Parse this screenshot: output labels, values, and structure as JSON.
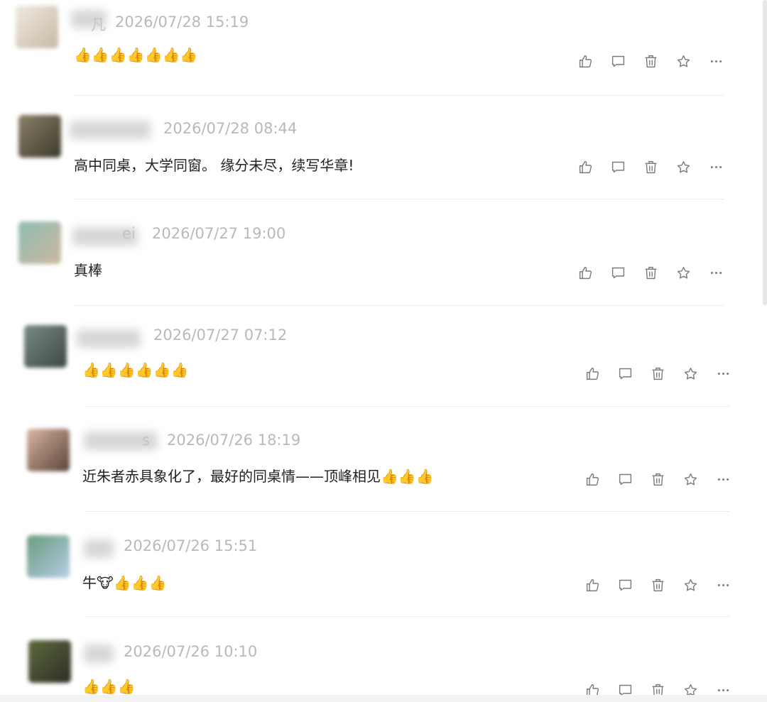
{
  "colors": {
    "timestamp": "#b9b9b9",
    "content_text": "#222222",
    "icon_stroke": "#7a7a7a",
    "divider": "#eeeeee"
  },
  "comments": [
    {
      "name_partial": "凡",
      "timestamp": "2026/07/28 15:19",
      "content": "👍👍👍👍👍👍👍",
      "avatar_colors": [
        "#efeae2",
        "#c7b8a3"
      ]
    },
    {
      "name_partial": "",
      "timestamp": "2026/07/28 08:44",
      "content": "高中同桌，大学同窗。 缘分未尽，续写华章!",
      "avatar_colors": [
        "#8a8068",
        "#3d3a2c"
      ]
    },
    {
      "name_partial": "ei",
      "timestamp": "2026/07/27 19:00",
      "content": "真棒",
      "avatar_colors": [
        "#8fbcb4",
        "#cdb79d"
      ]
    },
    {
      "name_partial": "",
      "timestamp": "2026/07/27 07:12",
      "content": "👍👍👍👍👍👍",
      "avatar_colors": [
        "#7b8a86",
        "#3b4744"
      ]
    },
    {
      "name_partial": "s",
      "timestamp": "2026/07/26 18:19",
      "content": "近朱者赤具象化了，最好的同桌情——顶峰相见👍👍👍",
      "avatar_colors": [
        "#d9b6a3",
        "#5a4337"
      ]
    },
    {
      "name_partial": "",
      "timestamp": "2026/07/26 15:51",
      "content": "牛🐮👍👍👍",
      "avatar_colors": [
        "#6a9c7d",
        "#b6cde6"
      ]
    },
    {
      "name_partial": "",
      "timestamp": "2026/07/26 10:10",
      "content": "👍👍👍",
      "avatar_colors": [
        "#5e6a3c",
        "#2b2d26"
      ]
    }
  ],
  "action_icons": [
    "like-icon",
    "comment-icon",
    "delete-icon",
    "favorite-icon",
    "more-icon"
  ]
}
